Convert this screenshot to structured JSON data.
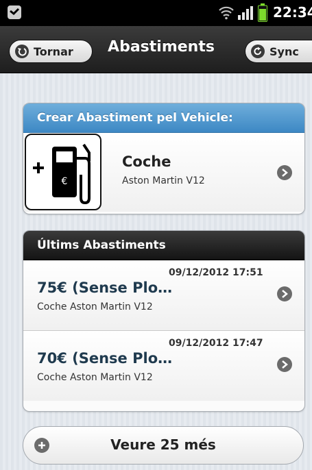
{
  "status_bar": {
    "time": "22:34",
    "icons": [
      "app-notification-icon",
      "wifi-icon",
      "signal-icon",
      "battery-icon"
    ]
  },
  "header": {
    "title": "Abastiments",
    "back_label": "Tornar",
    "sync_label": "Sync"
  },
  "create_section": {
    "title": "Crear Abastiment pel Vehicle:",
    "vehicle_name": "Coche",
    "vehicle_model": "Aston Martin V12",
    "icon": "fuel-pump-icon"
  },
  "recent_section": {
    "title": "Últims Abastiments",
    "items": [
      {
        "date": "09/12/2012 17:51",
        "title": "75€ (Sense Plo…",
        "subtitle": "Coche Aston Martin V12"
      },
      {
        "date": "09/12/2012 17:47",
        "title": "70€ (Sense Plo…",
        "subtitle": "Coche Aston Martin V12"
      }
    ]
  },
  "more_button": {
    "label": "Veure 25 més"
  },
  "colors": {
    "accent_blue": "#4a94cc",
    "dark_header": "#1e1e1e",
    "battery_green": "#7ddc2c"
  }
}
